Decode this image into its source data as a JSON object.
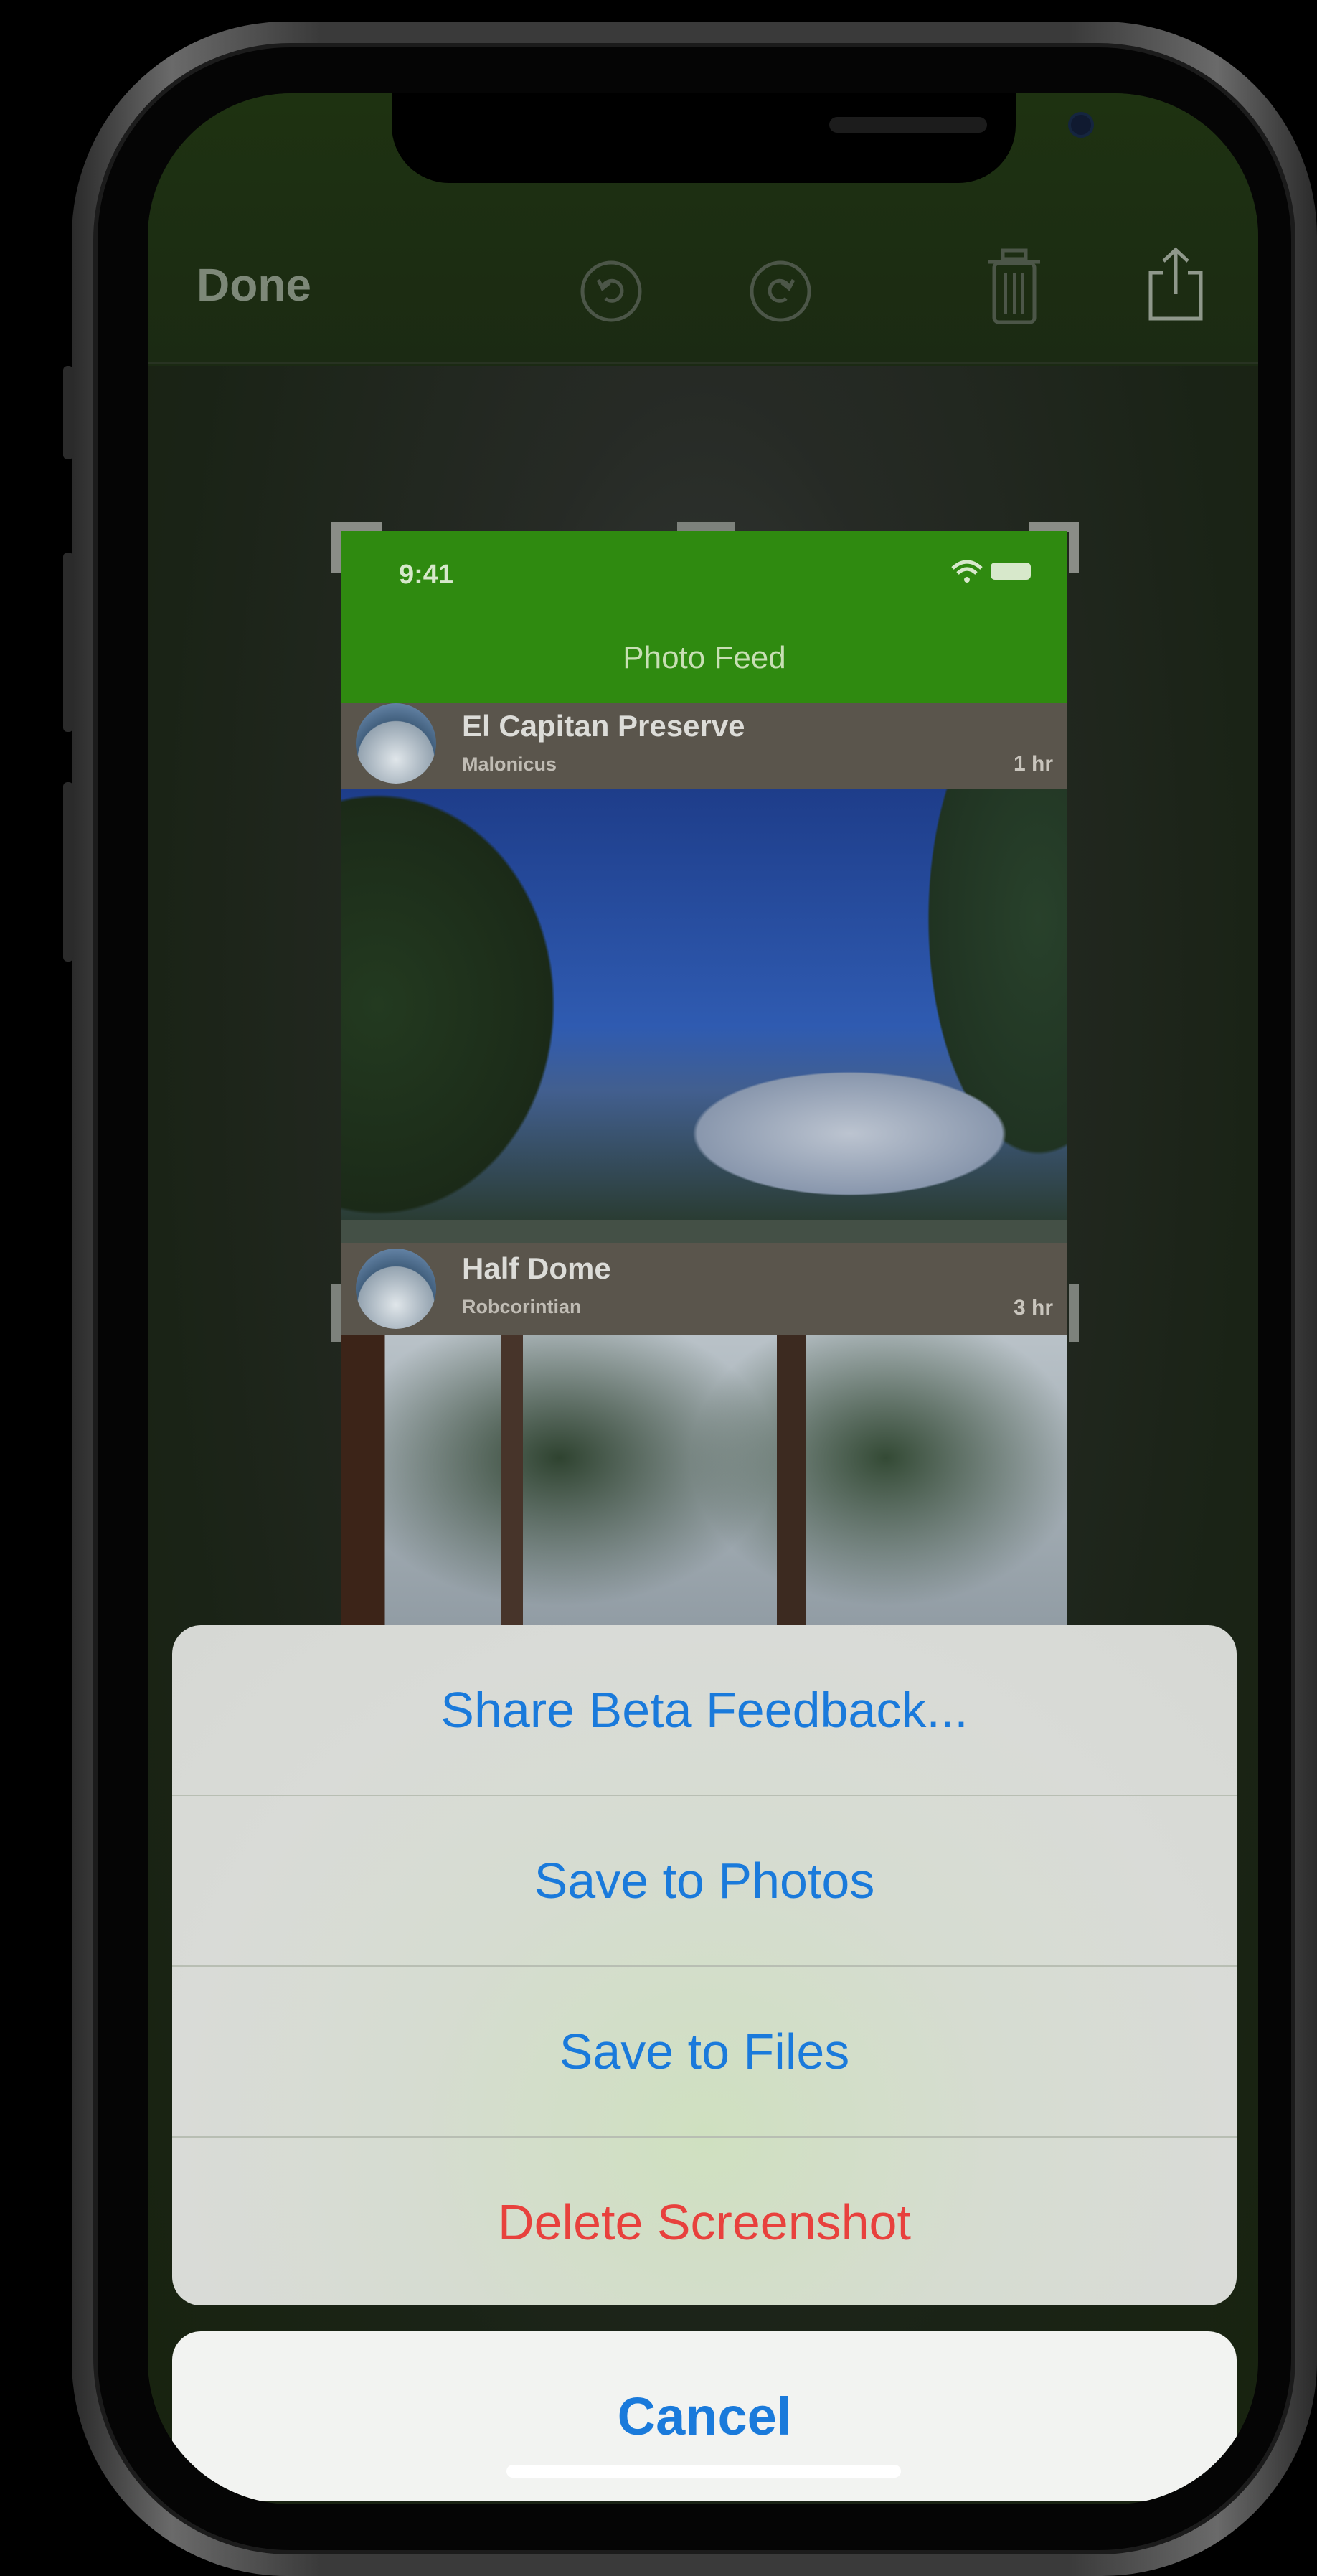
{
  "toolbar": {
    "done_label": "Done",
    "icons": [
      "undo-icon",
      "redo-icon",
      "trash-icon",
      "share-icon"
    ]
  },
  "screenshot_preview": {
    "status_time": "9:41",
    "nav_title": "Photo Feed",
    "posts": [
      {
        "title": "El Capitan Preserve",
        "user": "Malonicus",
        "time": "1 hr"
      },
      {
        "title": "Half Dome",
        "user": "Robcorintian",
        "time": "3 hr"
      }
    ]
  },
  "action_sheet": {
    "items": [
      {
        "label": "Share Beta Feedback..."
      },
      {
        "label": "Save to Photos"
      },
      {
        "label": "Save to Files"
      },
      {
        "label": "Delete Screenshot"
      }
    ],
    "cancel_label": "Cancel"
  },
  "colors": {
    "accent_blue": "#1a7adb",
    "destructive_red": "#e8413d",
    "header_green": "#2f8a10"
  }
}
